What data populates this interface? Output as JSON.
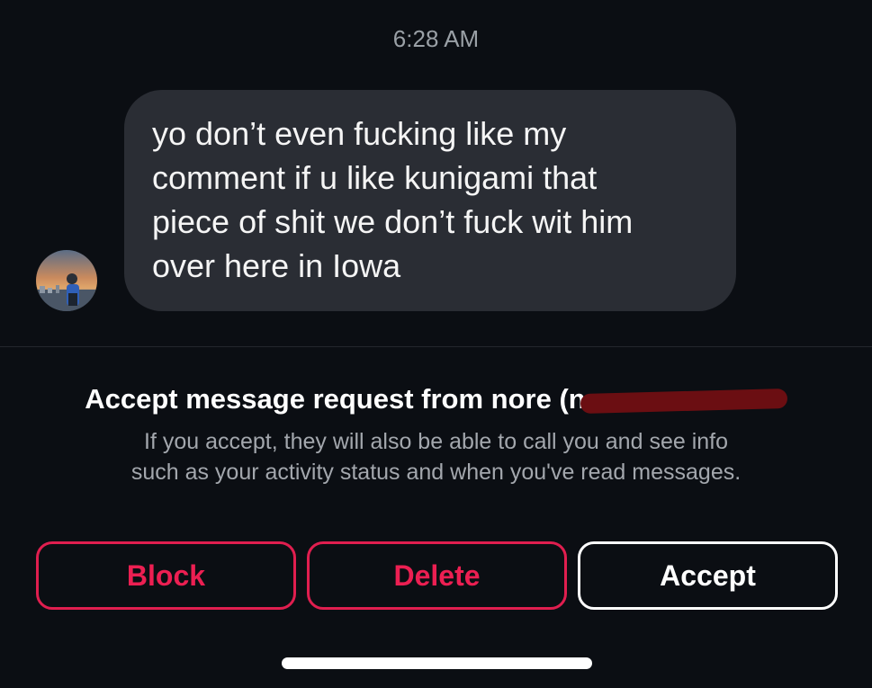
{
  "conversation": {
    "timestamp": "6:28 AM",
    "message": {
      "lines": [
        "yo don’t even fucking like my",
        "comment if u like kunigami that",
        "piece of shit we don’t fuck wit him",
        "over here in Iowa"
      ]
    }
  },
  "request": {
    "title": "Accept message request from nore (n",
    "description_lines": [
      "If you accept, they will also be able to call you and see info",
      "such as your activity status and when you've read messages."
    ]
  },
  "actions": {
    "block_label": "Block",
    "delete_label": "Delete",
    "accept_label": "Accept"
  },
  "colors": {
    "background": "#0b0e13",
    "bubble": "#2a2d34",
    "danger": "#e01e4f",
    "redaction": "#6b0e12"
  }
}
